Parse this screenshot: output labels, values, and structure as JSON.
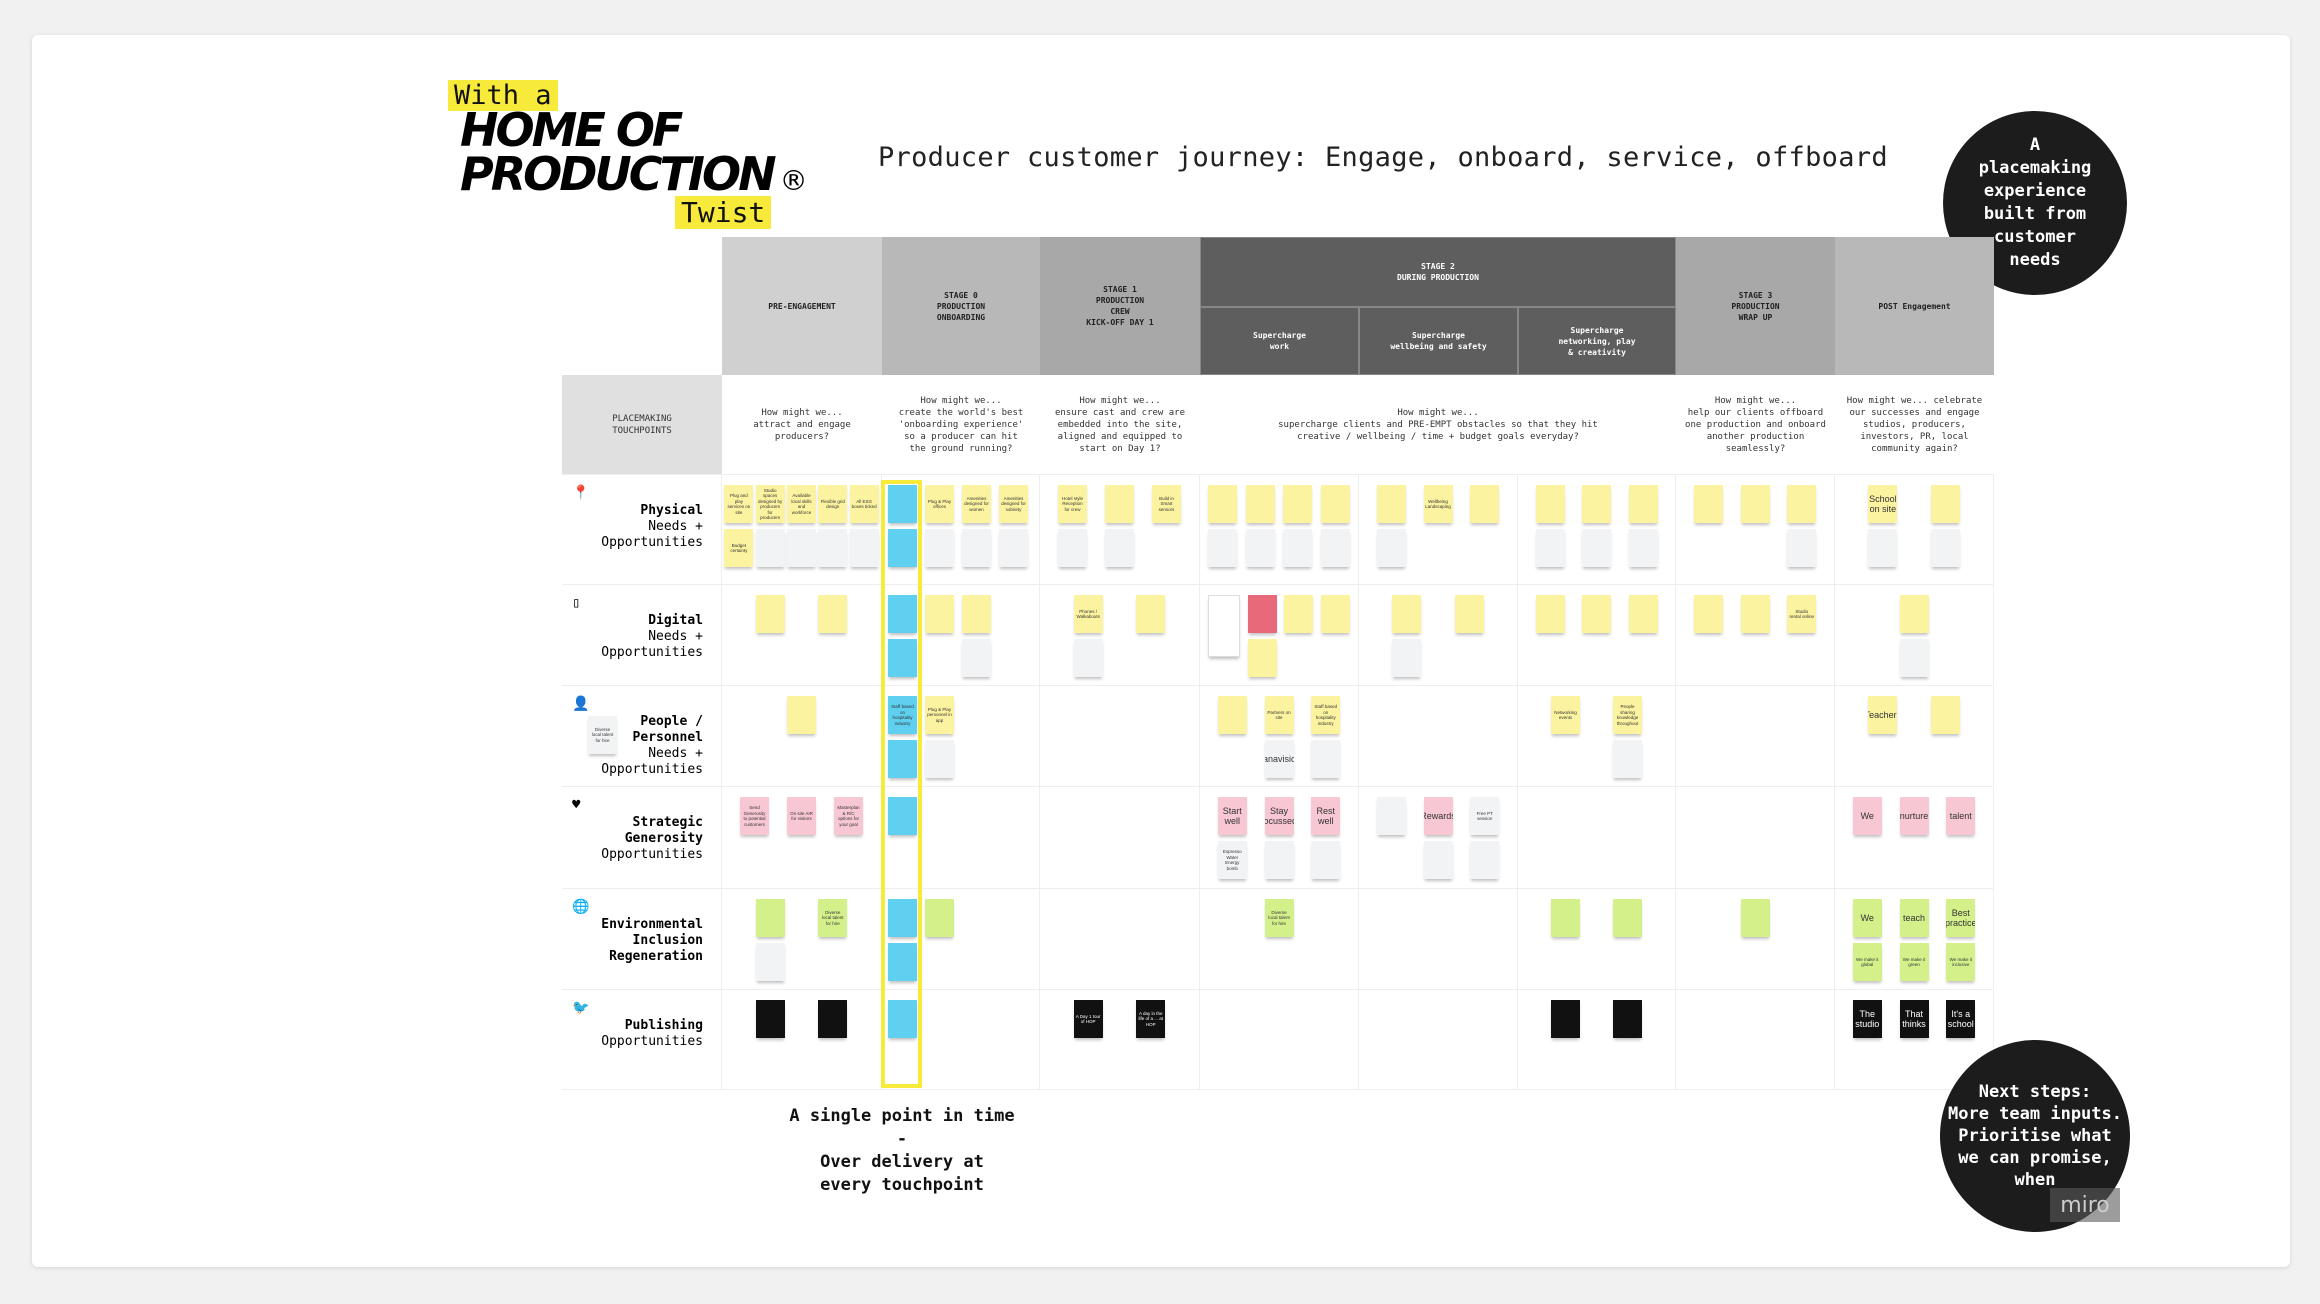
{
  "logo": {
    "with": "With a",
    "line1": "HOME OF",
    "line2": "PRODUCTION",
    "reg": "®",
    "twist": "Twist"
  },
  "title": "Producer customer journey: Engage, onboard, service, offboard",
  "circle_top": "A\nplacemaking\nexperience\nbuilt from\ncustomer\nneeds",
  "circle_bottom": "Next steps:\nMore team inputs.\nPrioritise what\nwe can promise,\nwhen",
  "watermark": "miro",
  "bottom_note": "A single point in time\n-\nOver delivery at\nevery touchpoint",
  "headers": {
    "pre": "PRE-ENGAGEMENT",
    "s0": "STAGE 0\nPRODUCTION\nONBOARDING",
    "s1": "STAGE 1\nPRODUCTION\nCREW\nKICK-OFF DAY 1",
    "s2": "STAGE 2\nDURING PRODUCTION",
    "s2a": "Supercharge\nwork",
    "s2b": "Supercharge\nwellbeing and safety",
    "s2c": "Supercharge\nnetworking, play\n& creativity",
    "s3": "STAGE 3\nPRODUCTION\nWRAP UP",
    "post": "POST Engagement"
  },
  "questions": {
    "touchpoints": "PLACEMAKING\nTOUCHPOINTS",
    "pre": "How might we...\nattract and engage\nproducers?",
    "s0": "How might we...\ncreate the world's best\n'onboarding experience'\nso a producer can hit\nthe ground running?",
    "s1": "How might we...\nensure cast and crew are\nembedded into the site,\naligned and equipped to\nstart on Day 1?",
    "s2": "How might we...\nsupercharge clients and PRE-EMPT obstacles so that they hit\ncreative / wellbeing / time + budget goals everyday?",
    "s3": "How might we...\nhelp our clients offboard\none production and onboard\nanother production\nseamlessly?",
    "post": "How might we... celebrate\nour successes and engage\nstudios, producers,\ninvestors, PR, local\ncommunity again?"
  },
  "colors": {
    "highlight": "#f7ea3a",
    "stage2": "#5e5e5e",
    "yellow_note": "#fbf3a0",
    "blue_note": "#5fd0f0",
    "pink_note": "#f7c7d3",
    "green_note": "#d3f08a"
  },
  "rows": [
    {
      "icon": "map-pin-icon",
      "glyph": "📍",
      "label": [
        {
          "t": "Physical",
          "b": true
        },
        {
          "t": "Needs +"
        },
        {
          "t": "Opportunities"
        }
      ],
      "cells": {
        "pre": [
          [
            {
              "c": "yellow",
              "t": "Plug and play services on site"
            },
            {
              "c": "yellow",
              "t": "Budget certainty"
            }
          ],
          [
            {
              "c": "yellow",
              "t": "Studio spaces designed by producers for producers"
            },
            {
              "c": "grey",
              "t": ""
            }
          ],
          [
            {
              "c": "yellow",
              "t": "Available local skills and workforce"
            },
            {
              "c": "grey",
              "t": ""
            }
          ],
          [
            {
              "c": "yellow",
              "t": "Flexible grid design"
            },
            {
              "c": "grey",
              "t": ""
            }
          ],
          [
            {
              "c": "yellow",
              "t": "All ESG boxes ticked"
            },
            {
              "c": "grey",
              "t": ""
            }
          ]
        ],
        "s0": [
          [
            {
              "c": "blue",
              "t": ""
            },
            {
              "c": "blue",
              "t": ""
            }
          ],
          [
            {
              "c": "yellow",
              "t": "Plug & Play offices"
            },
            {
              "c": "grey",
              "t": ""
            }
          ],
          [
            {
              "c": "yellow",
              "t": "Amenities designed for women"
            },
            {
              "c": "grey",
              "t": ""
            }
          ],
          [
            {
              "c": "yellow",
              "t": "Amenities designed for sobriety"
            },
            {
              "c": "grey",
              "t": ""
            }
          ]
        ],
        "s1": [
          [
            {
              "c": "yellow",
              "t": "Hotel style Reception for crew"
            },
            {
              "c": "grey",
              "t": ""
            }
          ],
          [
            {
              "c": "yellow",
              "t": ""
            },
            {
              "c": "grey",
              "t": ""
            }
          ],
          [
            {
              "c": "yellow",
              "t": "Build in Smart sensors"
            }
          ]
        ],
        "s2a": [
          [
            {
              "c": "yellow",
              "t": ""
            },
            {
              "c": "grey",
              "t": ""
            }
          ],
          [
            {
              "c": "yellow",
              "t": ""
            },
            {
              "c": "grey",
              "t": ""
            }
          ],
          [
            {
              "c": "yellow",
              "t": ""
            },
            {
              "c": "grey",
              "t": ""
            }
          ],
          [
            {
              "c": "yellow",
              "t": ""
            },
            {
              "c": "grey",
              "t": ""
            }
          ]
        ],
        "s2b": [
          [
            {
              "c": "yellow",
              "t": ""
            },
            {
              "c": "grey",
              "t": ""
            }
          ],
          [
            {
              "c": "yellow",
              "t": "Wellbeing Landscaping"
            }
          ],
          [
            {
              "c": "yellow",
              "t": ""
            }
          ]
        ],
        "s2c": [
          [
            {
              "c": "yellow",
              "t": ""
            },
            {
              "c": "grey",
              "t": ""
            }
          ],
          [
            {
              "c": "yellow",
              "t": ""
            },
            {
              "c": "grey",
              "t": ""
            }
          ],
          [
            {
              "c": "yellow",
              "t": ""
            },
            {
              "c": "grey",
              "t": ""
            }
          ]
        ],
        "s3": [
          [
            {
              "c": "yellow",
              "t": ""
            }
          ],
          [
            {
              "c": "yellow",
              "t": ""
            }
          ],
          [
            {
              "c": "yellow",
              "t": ""
            },
            {
              "c": "grey",
              "t": ""
            }
          ]
        ],
        "post": [
          [
            {
              "c": "yellow",
              "t": "School on site"
            },
            {
              "c": "grey",
              "t": ""
            }
          ],
          [
            {
              "c": "yellow",
              "t": ""
            },
            {
              "c": "grey",
              "t": ""
            }
          ]
        ]
      }
    },
    {
      "icon": "phone-icon",
      "glyph": "▯",
      "label": [
        {
          "t": "Digital",
          "b": true
        },
        {
          "t": "Needs +"
        },
        {
          "t": "Opportunities"
        }
      ],
      "cells": {
        "pre": [
          [
            {
              "c": "yellow",
              "t": ""
            }
          ],
          [
            {
              "c": "yellow",
              "t": ""
            }
          ]
        ],
        "s0": [
          [
            {
              "c": "blue",
              "t": ""
            },
            {
              "c": "blue",
              "t": ""
            }
          ],
          [
            {
              "c": "yellow",
              "t": ""
            }
          ],
          [
            {
              "c": "yellow",
              "t": ""
            },
            {
              "c": "grey",
              "t": ""
            }
          ]
        ],
        "s1": [
          [
            {
              "c": "yellow",
              "t": "Phones / Walkabouts"
            },
            {
              "c": "grey",
              "t": ""
            }
          ],
          [
            {
              "c": "yellow",
              "t": ""
            }
          ]
        ],
        "s2a": [
          [
            {
              "c": "white",
              "t": ""
            }
          ],
          [
            {
              "c": "red",
              "t": ""
            },
            {
              "c": "yellow",
              "t": ""
            }
          ],
          [
            {
              "c": "yellow",
              "t": ""
            }
          ],
          [
            {
              "c": "yellow",
              "t": ""
            }
          ]
        ],
        "s2b": [
          [
            {
              "c": "yellow",
              "t": ""
            },
            {
              "c": "grey",
              "t": ""
            }
          ],
          [
            {
              "c": "yellow",
              "t": ""
            }
          ]
        ],
        "s2c": [
          [
            {
              "c": "yellow",
              "t": ""
            }
          ],
          [
            {
              "c": "yellow",
              "t": ""
            }
          ],
          [
            {
              "c": "yellow",
              "t": ""
            }
          ]
        ],
        "s3": [
          [
            {
              "c": "yellow",
              "t": ""
            }
          ],
          [
            {
              "c": "yellow",
              "t": ""
            }
          ],
          [
            {
              "c": "yellow",
              "t": "Studio rental online"
            }
          ]
        ],
        "post": [
          [
            {
              "c": "yellow",
              "t": ""
            },
            {
              "c": "grey",
              "t": ""
            }
          ]
        ]
      }
    },
    {
      "icon": "person-icon",
      "glyph": "👤",
      "label": [
        {
          "t": "People /",
          "b": true
        },
        {
          "t": "Personnel",
          "b": true
        },
        {
          "t": "Needs +"
        },
        {
          "t": "Opportunities"
        }
      ],
      "side_note": "Diverse local talent for hire",
      "cells": {
        "pre": [
          [
            {
              "c": "yellow",
              "t": ""
            }
          ]
        ],
        "s0": [
          [
            {
              "c": "blue",
              "t": "Staff based on hospitality industry"
            },
            {
              "c": "blue",
              "t": ""
            }
          ],
          [
            {
              "c": "yellow",
              "t": "Plug & Play personnel in app"
            },
            {
              "c": "grey",
              "t": ""
            }
          ]
        ],
        "s1": [],
        "s2a": [
          [
            {
              "c": "yellow",
              "t": ""
            }
          ],
          [
            {
              "c": "yellow",
              "t": "Partners on site"
            },
            {
              "c": "grey",
              "t": "Panavision"
            }
          ],
          [
            {
              "c": "yellow",
              "t": "Staff based on hospitality industry"
            },
            {
              "c": "grey",
              "t": ""
            }
          ]
        ],
        "s2b": [],
        "s2c": [
          [
            {
              "c": "yellow",
              "t": "Networking events"
            }
          ],
          [
            {
              "c": "yellow",
              "t": "People sharing knowledge throughout"
            },
            {
              "c": "grey",
              "t": ""
            }
          ]
        ],
        "s3": [],
        "post": [
          [
            {
              "c": "yellow",
              "t": "Teachers"
            }
          ],
          [
            {
              "c": "yellow",
              "t": ""
            }
          ]
        ]
      }
    },
    {
      "icon": "heart-icon",
      "glyph": "♥",
      "label": [
        {
          "t": "Strategic",
          "b": true
        },
        {
          "t": "Generosity",
          "b": true
        },
        {
          "t": "Opportunities"
        }
      ],
      "cells": {
        "pre": [
          [
            {
              "c": "pink",
              "t": "Send Generosity to potential customers"
            }
          ],
          [
            {
              "c": "pink",
              "t": "On site AIR for visitors"
            }
          ],
          [
            {
              "c": "pink",
              "t": "Masterplan & R/C options for your goal"
            }
          ]
        ],
        "s0": [
          [
            {
              "c": "blue",
              "t": ""
            }
          ]
        ],
        "s1": [],
        "s2a": [
          [
            {
              "c": "pink",
              "t": "Start well"
            },
            {
              "c": "grey",
              "t": "Espresso Water Energy bomb"
            }
          ],
          [
            {
              "c": "pink",
              "t": "Stay focussed"
            },
            {
              "c": "grey",
              "t": ""
            }
          ],
          [
            {
              "c": "pink",
              "t": "Rest well"
            },
            {
              "c": "grey",
              "t": ""
            }
          ]
        ],
        "s2b": [
          [
            {
              "c": "grey",
              "t": ""
            }
          ],
          [
            {
              "c": "pink",
              "t": "Rewards"
            },
            {
              "c": "grey",
              "t": ""
            }
          ],
          [
            {
              "c": "grey",
              "t": "Free PT session"
            },
            {
              "c": "grey",
              "t": ""
            }
          ]
        ],
        "s2c": [],
        "s3": [],
        "post": [
          [
            {
              "c": "pink",
              "t": "We"
            }
          ],
          [
            {
              "c": "pink",
              "t": "nurture"
            }
          ],
          [
            {
              "c": "pink",
              "t": "talent"
            }
          ]
        ]
      }
    },
    {
      "icon": "globe-icon",
      "glyph": "🌐",
      "label": [
        {
          "t": "Environmental",
          "b": true
        },
        {
          "t": "Inclusion",
          "b": true
        },
        {
          "t": "Regeneration",
          "b": true
        }
      ],
      "cells": {
        "pre": [
          [
            {
              "c": "green",
              "t": ""
            },
            {
              "c": "grey",
              "t": ""
            }
          ],
          [
            {
              "c": "green",
              "t": "Diverse local talent for hire"
            }
          ]
        ],
        "s0": [
          [
            {
              "c": "blue",
              "t": ""
            },
            {
              "c": "blue",
              "t": ""
            }
          ],
          [
            {
              "c": "green",
              "t": ""
            }
          ]
        ],
        "s1": [],
        "s2a": [
          [
            {
              "c": "green",
              "t": "Diverse local talent for hire"
            }
          ]
        ],
        "s2b": [],
        "s2c": [
          [
            {
              "c": "green",
              "t": ""
            }
          ],
          [
            {
              "c": "green",
              "t": ""
            }
          ]
        ],
        "s3": [
          [
            {
              "c": "green",
              "t": ""
            }
          ]
        ],
        "post": [
          [
            {
              "c": "green",
              "t": "We"
            },
            {
              "c": "green",
              "t": "We make it global"
            }
          ],
          [
            {
              "c": "green",
              "t": "teach"
            },
            {
              "c": "green",
              "t": "We make it green"
            }
          ],
          [
            {
              "c": "green",
              "t": "Best practice"
            },
            {
              "c": "green",
              "t": "We make it inclusive"
            }
          ]
        ]
      }
    },
    {
      "icon": "twitter-bird-icon",
      "glyph": "🐦",
      "label": [
        {
          "t": "Publishing",
          "b": true
        },
        {
          "t": "Opportunities"
        }
      ],
      "cells": {
        "pre": [
          [
            {
              "c": "black",
              "t": ""
            }
          ],
          [
            {
              "c": "black",
              "t": ""
            }
          ]
        ],
        "s0": [
          [
            {
              "c": "blue",
              "t": ""
            }
          ]
        ],
        "s1": [
          [
            {
              "c": "black",
              "t": "A Day 1 tour of HOP"
            }
          ],
          [
            {
              "c": "black",
              "t": "A day in the life of a ... at HOP"
            }
          ]
        ],
        "s2a": [],
        "s2b": [],
        "s2c": [
          [
            {
              "c": "black",
              "t": ""
            }
          ],
          [
            {
              "c": "black",
              "t": ""
            }
          ]
        ],
        "s3": [],
        "post": [
          [
            {
              "c": "black",
              "t": "The studio"
            }
          ],
          [
            {
              "c": "black",
              "t": "That thinks"
            }
          ],
          [
            {
              "c": "black",
              "t": "It's a school"
            }
          ]
        ]
      }
    }
  ]
}
